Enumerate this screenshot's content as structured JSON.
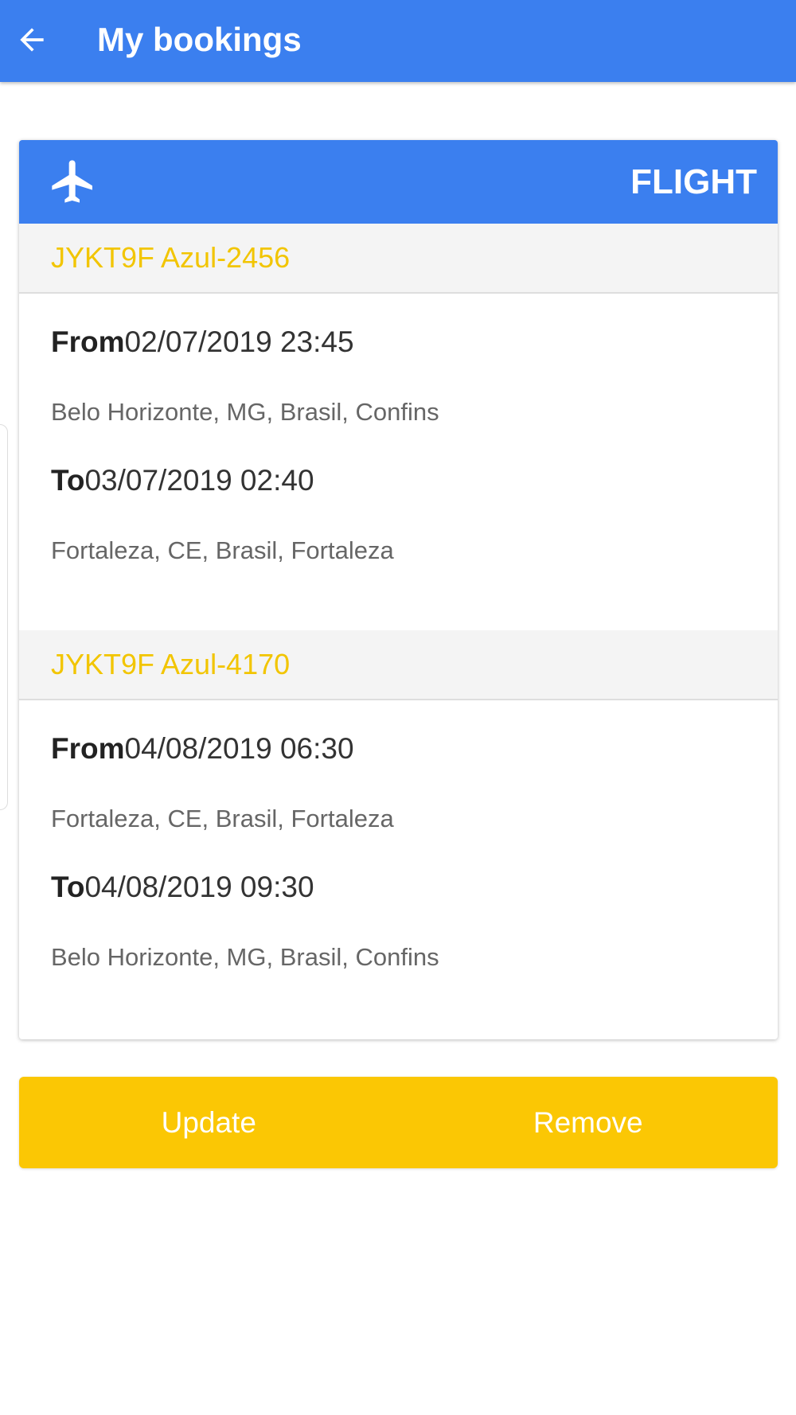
{
  "header": {
    "title": "My bookings",
    "back_icon": "arrow-left-icon"
  },
  "booking": {
    "type_label": "FLIGHT",
    "type_icon": "airplane-icon",
    "segments": [
      {
        "title": "JYKT9F Azul-2456",
        "from_label": "From",
        "from_datetime": "02/07/2019 23:45",
        "from_place": "Belo Horizonte, MG, Brasil, Confins",
        "to_label": "To",
        "to_datetime": "03/07/2019 02:40",
        "to_place": "Fortaleza, CE, Brasil, Fortaleza"
      },
      {
        "title": "JYKT9F Azul-4170",
        "from_label": "From",
        "from_datetime": "04/08/2019 06:30",
        "from_place": "Fortaleza, CE, Brasil, Fortaleza",
        "to_label": "To",
        "to_datetime": "04/08/2019 09:30",
        "to_place": "Belo Horizonte, MG, Brasil, Confins"
      }
    ]
  },
  "actions": {
    "update_label": "Update",
    "remove_label": "Remove"
  },
  "colors": {
    "primary": "#3b7fef",
    "accent": "#fbc704",
    "segment_title": "#f2c500"
  }
}
